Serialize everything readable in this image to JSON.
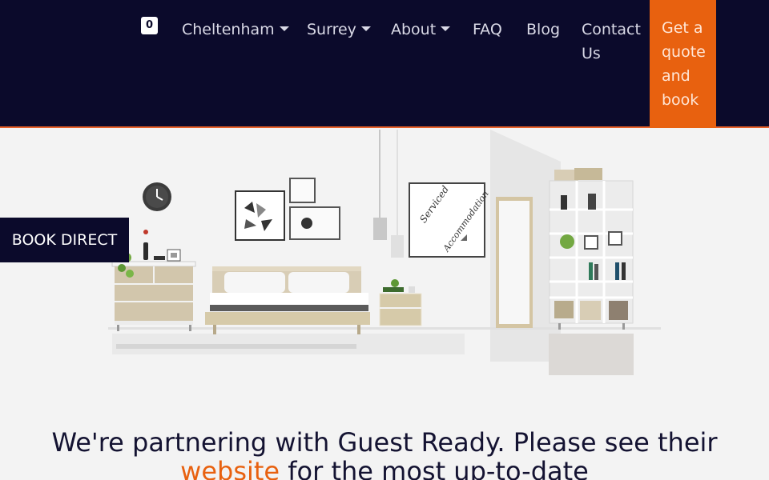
{
  "nav": {
    "cart_count": "0",
    "items": [
      {
        "label": "Cheltenham",
        "dropdown": true
      },
      {
        "label": "Surrey",
        "dropdown": true
      },
      {
        "label": "About",
        "dropdown": true
      },
      {
        "label": "FAQ",
        "dropdown": false
      },
      {
        "label": "Blog",
        "dropdown": false
      },
      {
        "label": "Contact Us",
        "dropdown": false
      }
    ],
    "cta_label": "Get a quote and book"
  },
  "hero": {
    "book_direct_label": "BOOK DIRECT",
    "frame_text_line1": "Serviced",
    "frame_text_line2": "Accommodation"
  },
  "notice": {
    "text_before": "We're partnering with Guest Ready. Please see their ",
    "link_text": "website",
    "text_after": " for the most up-to-date"
  },
  "colors": {
    "navy": "#0b0a2b",
    "accent_orange": "#e8610f",
    "background": "#f3f3f3"
  }
}
